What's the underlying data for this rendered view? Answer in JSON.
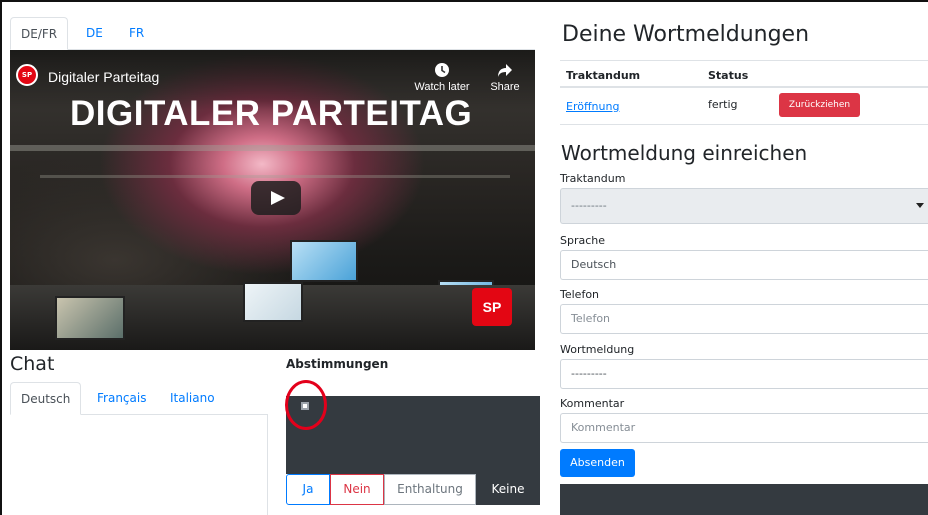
{
  "lang_tabs": [
    "DE/FR",
    "DE",
    "FR"
  ],
  "video": {
    "channel_title": "Digitaler Parteitag",
    "overlay_title": "DIGITALER PARTEITAG",
    "watch_later": "Watch later",
    "share": "Share",
    "channel_logo": "SP",
    "badge": "SP",
    "icons": {
      "watch_later": "clock-icon",
      "share": "share-arrow-icon",
      "play": "play-icon"
    }
  },
  "chat": {
    "title": "Chat",
    "tabs": [
      "Deutsch",
      "Français",
      "Italiano"
    ]
  },
  "votes": {
    "title": "Abstimmungen",
    "buttons": [
      "Ja",
      "Nein",
      "Enthaltung",
      "Keine"
    ]
  },
  "requests": {
    "title": "Deine Wortmeldungen",
    "columns": [
      "Traktandum",
      "Status"
    ],
    "rows": [
      {
        "traktandum": "Eröffnung",
        "status": "fertig",
        "action": "Zurückziehen"
      }
    ]
  },
  "form": {
    "title": "Wortmeldung einreichen",
    "traktandum_label": "Traktandum",
    "traktandum_value": "---------",
    "sprache_label": "Sprache",
    "sprache_value": "Deutsch",
    "telefon_label": "Telefon",
    "telefon_placeholder": "Telefon",
    "wortmeldung_label": "Wortmeldung",
    "wortmeldung_value": "---------",
    "kommentar_label": "Kommentar",
    "kommentar_placeholder": "Kommentar",
    "submit": "Absenden"
  },
  "colors": {
    "primary": "#007bff",
    "danger": "#dc3545",
    "dark": "#343a40",
    "highlight_circle": "#e3001b",
    "sp_red": "#e30613"
  }
}
